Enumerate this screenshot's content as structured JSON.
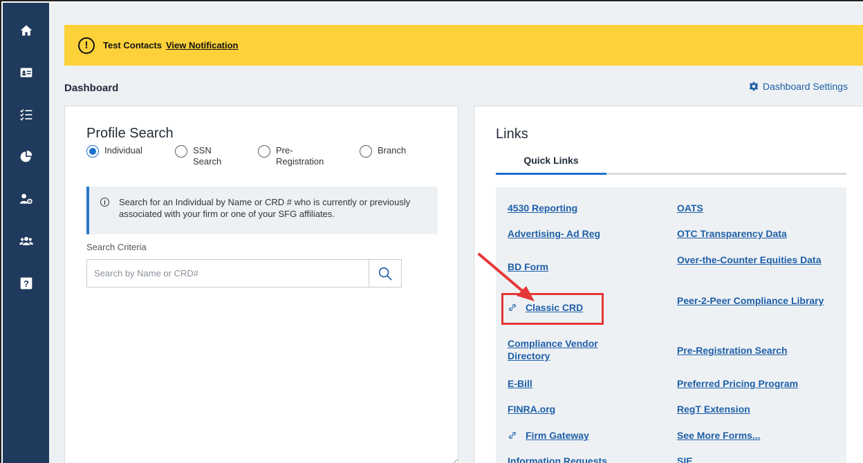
{
  "sidebar": {
    "items": [
      {
        "icon": "home-icon"
      },
      {
        "icon": "contact-card-icon"
      },
      {
        "icon": "checklist-icon"
      },
      {
        "icon": "pie-chart-icon"
      },
      {
        "icon": "user-settings-icon"
      },
      {
        "icon": "users-group-icon"
      },
      {
        "icon": "help-icon"
      }
    ]
  },
  "banner": {
    "title": "Test Contacts",
    "link": "View Notification",
    "color": "#fdd13a"
  },
  "dashboard": {
    "title": "Dashboard",
    "settings_label": "Dashboard Settings"
  },
  "profile_search": {
    "title": "Profile Search",
    "options": [
      {
        "label": "Individual",
        "checked": true
      },
      {
        "label": "SSN Search",
        "checked": false
      },
      {
        "label": "Pre-Registration",
        "checked": false
      },
      {
        "label": "Branch",
        "checked": false
      }
    ],
    "info": "Search for an Individual by Name or CRD # who is currently or previously associated with your firm or one of your SFG affiliates.",
    "criteria_label": "Search Criteria",
    "search_placeholder": "Search by Name or CRD#"
  },
  "links": {
    "title": "Links",
    "tab": "Quick Links",
    "left": [
      "4530 Reporting",
      "Advertising- Ad Reg",
      "BD Form",
      "Classic CRD",
      "Compliance Vendor Directory",
      "E-Bill",
      "FINRA.org",
      "Firm Gateway",
      "Information Requests"
    ],
    "right": [
      "OATS",
      "OTC Transparency Data",
      "Over-the-Counter Equities Data",
      "Peer-2-Peer Compliance Library",
      "Pre-Registration Search",
      "Preferred Pricing Program",
      "RegT Extension",
      "See More Forms...",
      "SIE"
    ]
  },
  "colors": {
    "sidebar": "#1f3a5c",
    "link": "#1d5fa8",
    "accent": "#1d6fd0",
    "highlight": "#e53636"
  }
}
